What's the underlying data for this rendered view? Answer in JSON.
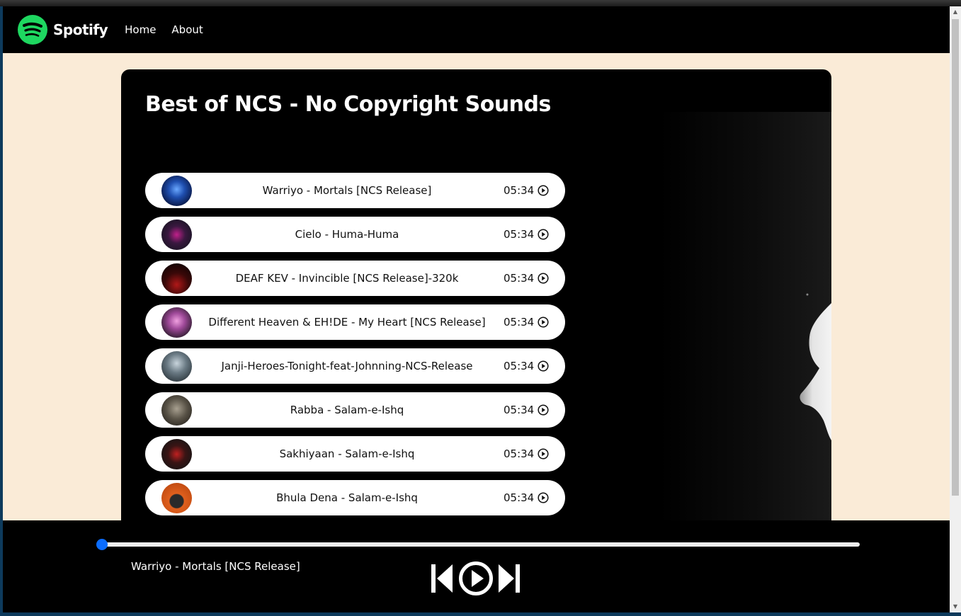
{
  "brand": {
    "name": "Spotify",
    "color": "#1ed760"
  },
  "nav": {
    "home": "Home",
    "about": "About"
  },
  "playlist": {
    "title": "Best of NCS - No Copyright Sounds"
  },
  "songs": [
    {
      "name": "Warriyo - Mortals [NCS Release]",
      "duration": "05:34",
      "cover_color": "#1a3a8c"
    },
    {
      "name": "Cielo - Huma-Huma",
      "duration": "05:34",
      "cover_color": "#2a1f3a"
    },
    {
      "name": "DEAF KEV - Invincible [NCS Release]-320k",
      "duration": "05:34",
      "cover_color": "#3a0a0a"
    },
    {
      "name": "Different Heaven & EH!DE - My Heart [NCS Release]",
      "duration": "05:34",
      "cover_color": "#6a3a6a"
    },
    {
      "name": "Janji-Heroes-Tonight-feat-Johnning-NCS-Release",
      "duration": "05:34",
      "cover_color": "#5a6a74"
    },
    {
      "name": "Rabba - Salam-e-Ishq",
      "duration": "05:34",
      "cover_color": "#5a5448"
    },
    {
      "name": "Sakhiyaan - Salam-e-Ishq",
      "duration": "05:34",
      "cover_color": "#2a2a2a"
    },
    {
      "name": "Bhula Dena - Salam-e-Ishq",
      "duration": "05:34",
      "cover_color": "#d8581a"
    }
  ],
  "player": {
    "now_playing": "Warriyo - Mortals [NCS Release]",
    "progress": 0,
    "accent": "#0b6dff"
  }
}
